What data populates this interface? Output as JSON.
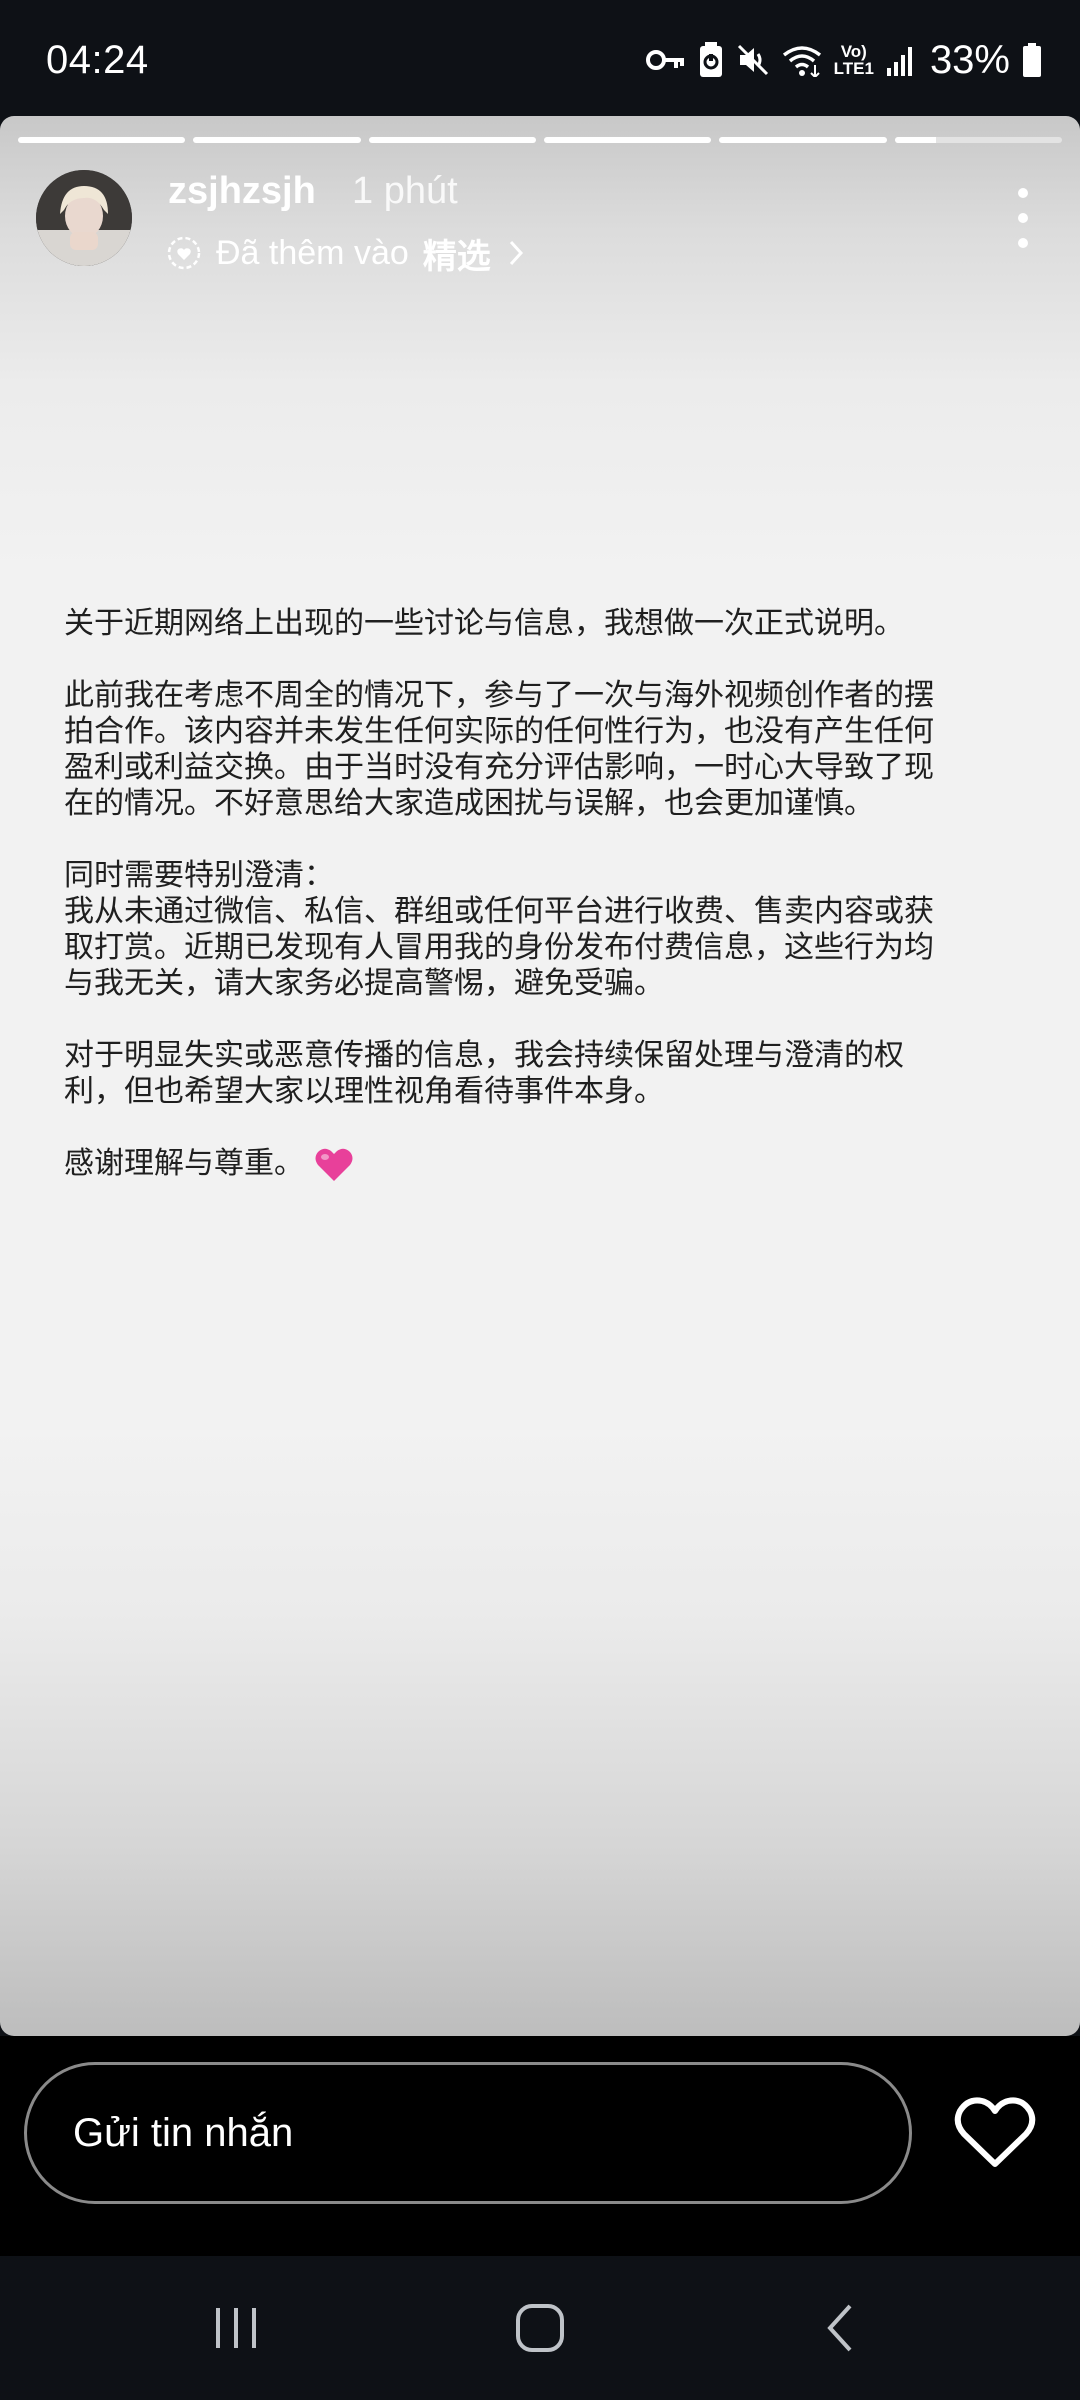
{
  "status_bar": {
    "time": "04:24",
    "network_label_top": "Vo)",
    "network_label_bottom": "LTE1",
    "battery_percent": "33%",
    "icons": [
      "key-icon",
      "battery-saver-icon",
      "mute-icon",
      "wifi-icon",
      "volte-icon",
      "signal-icon",
      "battery-icon"
    ]
  },
  "story": {
    "progress": [
      1,
      1,
      1,
      1,
      1,
      0.25
    ],
    "username": "zsjhzsjh",
    "time_ago": "1 phút",
    "featured_prefix": "Đã thêm vào",
    "featured_highlight": "精选",
    "text": {
      "p1": [
        "关于近期网络上出现的一些讨论与信息，我想做一次正式说明。"
      ],
      "p2": [
        "此前我在考虑不周全的情况下，参与了一次与海外视频创作者的摆",
        "拍合作。该内容并未发生任何实际的任何性行为，也没有产生任何",
        "盈利或利益交换。由于当时没有充分评估影响，一时心大导致了现",
        "在的情况。不好意思给大家造成困扰与误解，也会更加谨慎。"
      ],
      "p3": [
        "同时需要特别澄清：",
        "我从未通过微信、私信、群组或任何平台进行收费、售卖内容或获",
        "取打赏。近期已发现有人冒用我的身份发布付费信息，这些行为均",
        "与我无关，请大家务必提高警惕，避免受骗。"
      ],
      "p4": [
        "对于明显失实或恶意传播的信息，我会持续保留处理与澄清的权",
        "利，但也希望大家以理性视角看待事件本身。"
      ],
      "p5": [
        "感谢理解与尊重。"
      ]
    }
  },
  "reply": {
    "placeholder": "Gửi tin nhắn"
  },
  "colors": {
    "heart_emoji": "#e8409a",
    "background": "#0e1116"
  }
}
